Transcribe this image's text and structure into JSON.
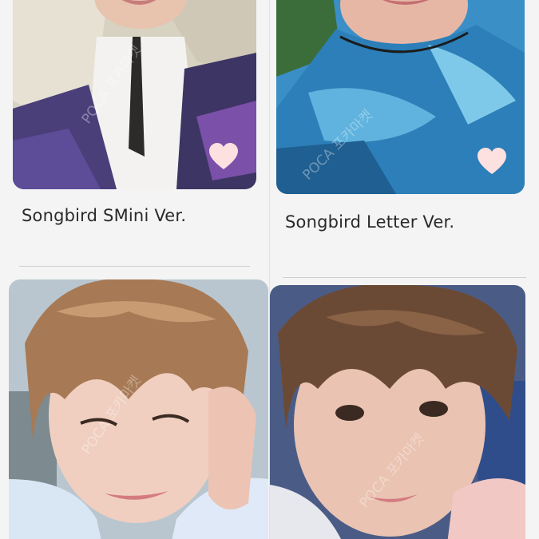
{
  "cards": [
    {
      "title": "Songbird SMini Ver.",
      "favorite_icon": "heart-icon",
      "watermark": "POCA 포카마켓"
    },
    {
      "title": "Songbird Letter Ver.",
      "favorite_icon": "heart-icon",
      "watermark": "POCA 포카마켓"
    },
    {
      "title": "",
      "watermark": "POCA 포카마켓"
    },
    {
      "title": "",
      "watermark": "POCA 포카마켓"
    }
  ],
  "colors": {
    "background": "#f4f4f4",
    "heart_fill": "#fde0e0",
    "divider": "#cfcfcf",
    "title_text": "#2a2a2a"
  }
}
